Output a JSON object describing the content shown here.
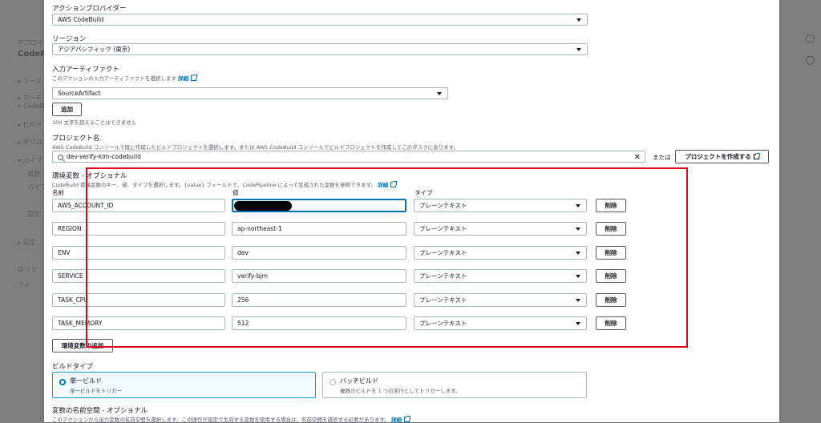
{
  "background": {
    "left_texts": [
      "デプロイ",
      "CodePi",
      "▸ ソース",
      "▸ アーテ",
      "• CodeB",
      "▸ ビルド",
      "▸ デプロ",
      "▾ パイプ",
      "履歴",
      "パイプ",
      "設定",
      "▸ 設定",
      "Q リソ",
      "フィ"
    ]
  },
  "provider": {
    "label": "アクションプロバイダー",
    "value": "AWS CodeBuild"
  },
  "region": {
    "label": "リージョン",
    "value": "アジアパシフィック (東京)"
  },
  "input_artifact": {
    "label": "入力アーティファクト",
    "hint": "このアクションの入力アーティファクトを選択します",
    "detail_link": "詳細",
    "value": "SourceArtifact",
    "add_button": "追加",
    "limit_note": "100 文字を超えることはできません"
  },
  "project": {
    "label": "プロジェクト名",
    "hint": "AWS CodeBuild コンソールで既に作成したビルドプロジェクトを選択します。または AWS CodeBuild コンソールでビルドプロジェクトを作成してこのタスクに戻ります。",
    "value": "dev-verify-kim-codebuild",
    "or_text": "または",
    "create_button": "プロジェクトを作成する"
  },
  "env_vars": {
    "label": "環境変数 - オプショナル",
    "hint": "CodeBuild 環境変数のキー、値、タイプを選択します。{value} フィールドで、CodePipeline によって生成された変数を参照できます。",
    "detail_link": "詳細",
    "col_name": "名前",
    "col_value": "値",
    "col_type": "タイプ",
    "remove_label": "削除",
    "add_button": "環境変数の追加",
    "rows": [
      {
        "name": "AWS_ACCOUNT_ID",
        "value": "",
        "type": "プレーンテキスト"
      },
      {
        "name": "REGION",
        "value": "ap-northeast-1",
        "type": "プレーンテキスト"
      },
      {
        "name": "ENV",
        "value": "dev",
        "type": "プレーンテキスト"
      },
      {
        "name": "SERVICE",
        "value": "verify-bjm",
        "type": "プレーンテキスト"
      },
      {
        "name": "TASK_CPU",
        "value": "256",
        "type": "プレーンテキスト"
      },
      {
        "name": "TASK_MEMORY",
        "value": "512",
        "type": "プレーンテキスト"
      }
    ]
  },
  "build_type": {
    "label": "ビルドタイプ",
    "single_title": "単一ビルド",
    "single_desc": "単一ビルドをトリガー",
    "batch_title": "バッチビルド",
    "batch_desc": "複数のビルドを 1 つの実行としてトリガーします。"
  },
  "namespace": {
    "label": "変数の名前空間 - オプショナル",
    "hint": "このアクションから出力変数の名前空間を選択します。この操作が設定で生成する変数を使用する場合は、名前空間を選択する必要があります。",
    "detail_link": "詳細"
  }
}
